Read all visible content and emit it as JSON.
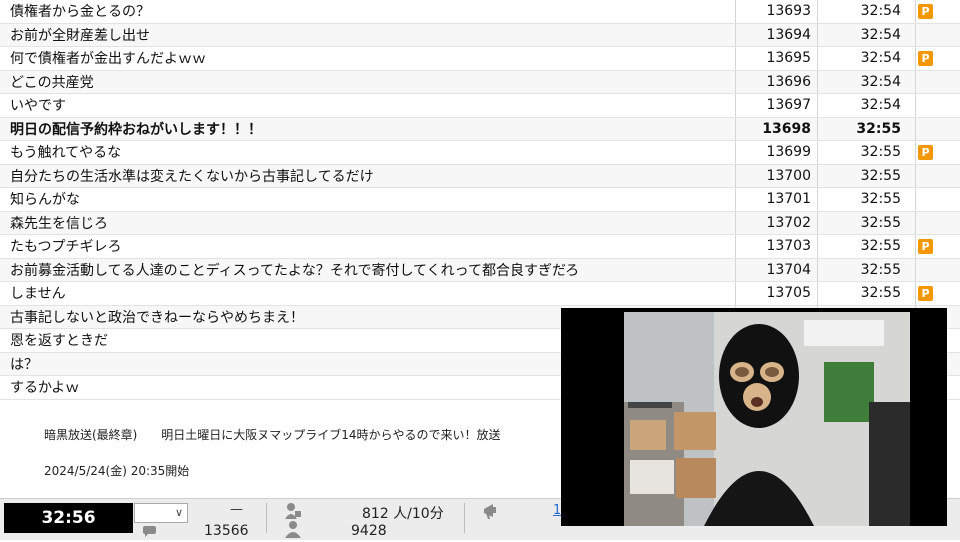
{
  "comments": [
    {
      "text": "債権者から金とるの？",
      "no": "13693",
      "time": "32:54",
      "premium": true,
      "bold": false
    },
    {
      "text": "お前が全財産差し出せ",
      "no": "13694",
      "time": "32:54",
      "premium": false,
      "bold": false
    },
    {
      "text": "何で債権者が金出すんだよｗｗ",
      "no": "13695",
      "time": "32:54",
      "premium": true,
      "bold": false
    },
    {
      "text": "どこの共産党",
      "no": "13696",
      "time": "32:54",
      "premium": false,
      "bold": false
    },
    {
      "text": "いやです",
      "no": "13697",
      "time": "32:54",
      "premium": false,
      "bold": false
    },
    {
      "text": "明日の配信予約枠おねがいします！！！",
      "no": "13698",
      "time": "32:55",
      "premium": false,
      "bold": true
    },
    {
      "text": "もう触れてやるな",
      "no": "13699",
      "time": "32:55",
      "premium": true,
      "bold": false
    },
    {
      "text": "自分たちの生活水準は変えたくないから古事記してるだけ",
      "no": "13700",
      "time": "32:55",
      "premium": false,
      "bold": false
    },
    {
      "text": "知らんがな",
      "no": "13701",
      "time": "32:55",
      "premium": false,
      "bold": false
    },
    {
      "text": "森先生を信じろ",
      "no": "13702",
      "time": "32:55",
      "premium": false,
      "bold": false
    },
    {
      "text": "たもつプチギレろ",
      "no": "13703",
      "time": "32:55",
      "premium": true,
      "bold": false
    },
    {
      "text": "お前募金活動してる人達のことディスってたよな？それで寄付してくれって都合良すぎだろ",
      "no": "13704",
      "time": "32:55",
      "premium": false,
      "bold": false
    },
    {
      "text": "しません",
      "no": "13705",
      "time": "32:55",
      "premium": true,
      "bold": false
    },
    {
      "text": "古事記しないと政治できねーならやめちまえ！",
      "no": "",
      "time": "",
      "premium": false,
      "bold": false
    },
    {
      "text": "恩を返すときだ",
      "no": "",
      "time": "",
      "premium": false,
      "bold": false
    },
    {
      "text": "は？",
      "no": "",
      "time": "",
      "premium": false,
      "bold": false
    },
    {
      "text": "するかよｗ",
      "no": "",
      "time": "",
      "premium": false,
      "bold": false
    }
  ],
  "premium_badge": "P",
  "broadcast": {
    "title": "暗黒放送(最終章)",
    "subtitle": "明日土曜日に大阪ヌマップライブ14時からやるので来い！放送",
    "start": "2024/5/24(金) 20:35開始"
  },
  "status": {
    "clock": "32:56",
    "dash": "—",
    "total_comments": "13566",
    "viewers_rate": "812 人/10分",
    "viewers_total": "9428",
    "link_text": "1"
  },
  "colors": {
    "premium_badge": "#f39800",
    "clock_bg": "#000000",
    "link": "#2a6bd1"
  }
}
